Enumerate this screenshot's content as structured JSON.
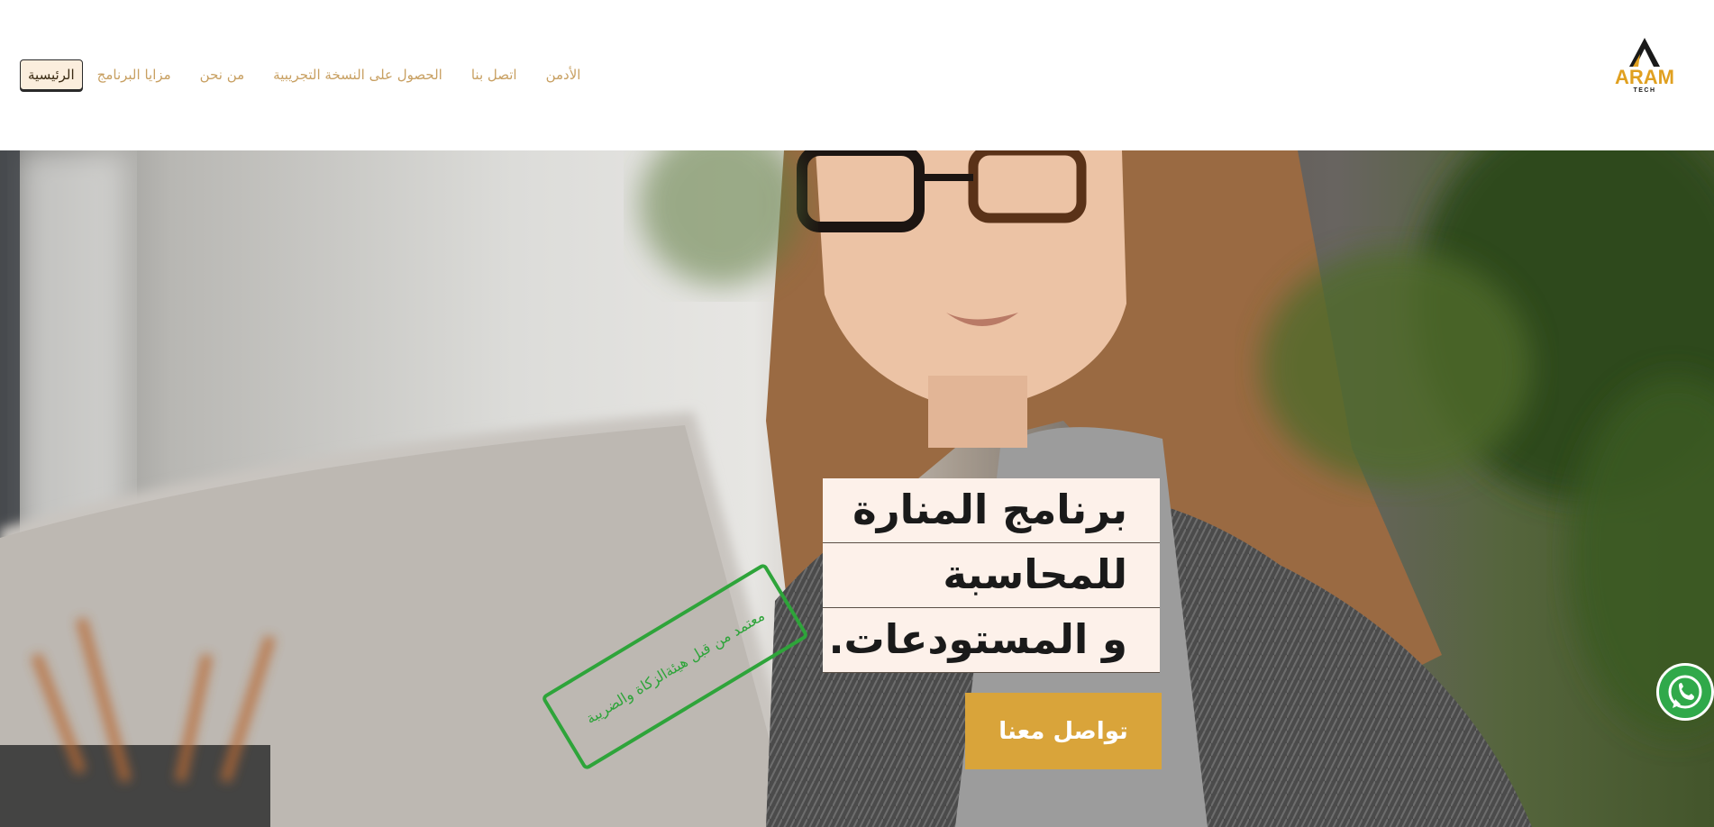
{
  "header": {
    "logo": {
      "name": "aram-tech-logo",
      "word": "ARAM",
      "subword": "TECH",
      "accent_color": "#e0a020"
    },
    "nav": [
      {
        "label": "الرئيسية",
        "active": true
      },
      {
        "label": "مزايا البرنامج",
        "active": false
      },
      {
        "label": "من نحن",
        "active": false
      },
      {
        "label": "الحصول على النسخة التجريبية",
        "active": false
      },
      {
        "label": "اتصل بنا",
        "active": false
      },
      {
        "label": "الأدمن",
        "active": false
      }
    ]
  },
  "hero": {
    "title_lines": [
      "برنامج المنارة",
      "للمحاسبة",
      "و المستودعات."
    ],
    "cta_label": "تواصل معنا",
    "stamp_text": "معتمد من قبل هيئةالزكاة والضريبة",
    "cta_color": "#d9a43a",
    "stamp_color": "#2ea43a"
  },
  "floating": {
    "whatsapp_icon": "whatsapp-icon",
    "whatsapp_color": "#30a94a"
  }
}
